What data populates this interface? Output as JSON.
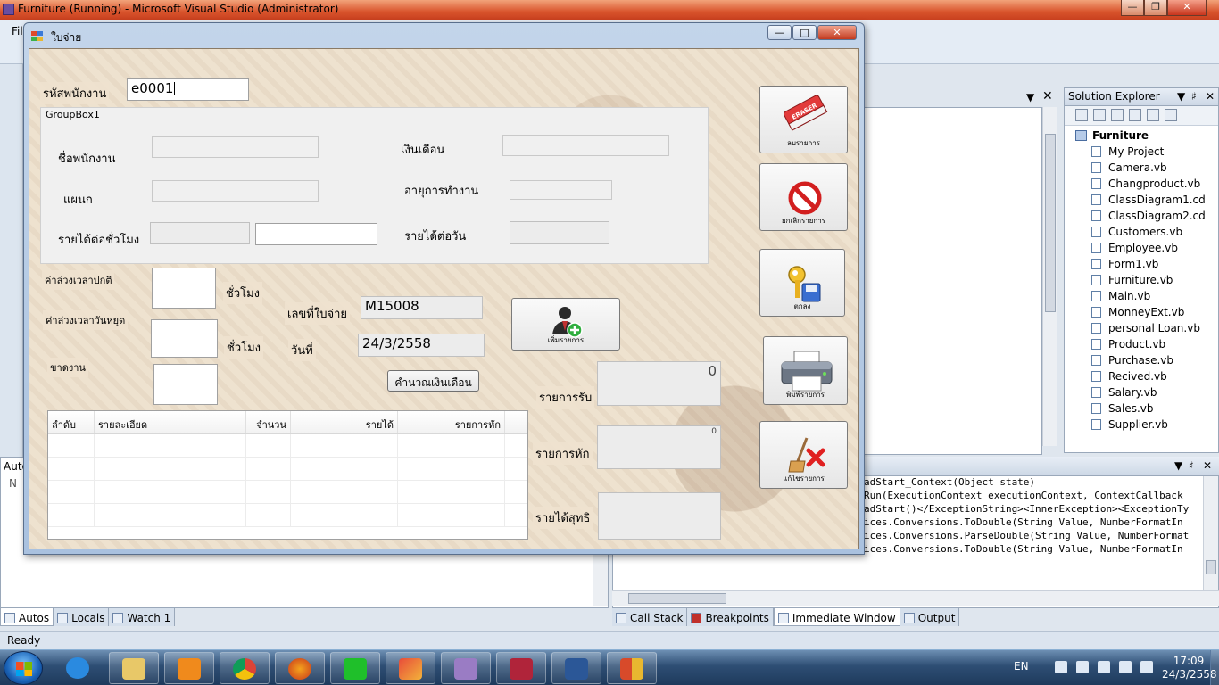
{
  "vs": {
    "title": "Furniture (Running) - Microsoft Visual Studio (Administrator)",
    "menu_partial": "Fil",
    "status": "Ready",
    "solution_explorer": {
      "title": "Solution Explorer",
      "root": "Furniture",
      "items": [
        "My Project",
        "Camera.vb",
        "Changproduct.vb",
        "ClassDiagram1.cd",
        "ClassDiagram2.cd",
        "Customers.vb",
        "Employee.vb",
        "Form1.vb",
        "Furniture.vb",
        "Main.vb",
        "MonneyExt.vb",
        "personal Loan.vb",
        "Product.vb",
        "Purchase.vb",
        "Recived.vb",
        "Salary.vb",
        "Sales.vb",
        "Supplier.vb"
      ]
    },
    "autos": {
      "title": "Auto",
      "header": "N"
    },
    "immediate_lines": [
      "adStart_Context(Object state)",
      "Run(ExecutionContext executionContext, ContextCallback",
      "adStart()</ExceptionString><InnerException><ExceptionTy",
      "ices.Conversions.ToDouble(String Value, NumberFormatIn",
      "ices.Conversions.ParseDouble(String Value, NumberFormat",
      "ices.Conversions.ToDouble(String Value, NumberFormatIn"
    ],
    "left_tabs": [
      "Autos",
      "Locals",
      "Watch 1"
    ],
    "right_tabs": [
      "Call Stack",
      "Breakpoints",
      "Immediate Window",
      "Output"
    ]
  },
  "taskbar": {
    "lang": "EN",
    "time": "17:09",
    "date": "24/3/2558"
  },
  "form": {
    "title": "ใบจ่าย",
    "employee_id_label": "รหัสพนักงาน",
    "employee_id_value": "e0001",
    "groupbox_title": "GroupBox1",
    "name_label": "ชื่อพนักงาน",
    "dept_label": "แผนก",
    "hourly_label": "รายได้ต่อชั่วโมง",
    "salary_label": "เงินเดือน",
    "tenure_label": "อายุการทำงาน",
    "daily_label": "รายได้ต่อวัน",
    "ot_normal_label": "ค่าล่วงเวลาปกติ",
    "ot_holiday_label": "ค่าล่วงเวลาวันหยุด",
    "absent_label": "ขาดงาน",
    "hour_unit": "ชั่วโมง",
    "hour_unit2": "ชั่วโมง",
    "payslip_no_label": "เลขที่ใบจ่าย",
    "payslip_no_value": "M15008",
    "date_label": "วันที่",
    "date_value": "24/3/2558",
    "calc_button": "คำนวณเงินเดือน",
    "add_item_button": "เพิ่มรายการ",
    "income_label": "รายการรับ",
    "income_value": "0",
    "deduct_label": "รายการหัก",
    "deduct_value": "0",
    "net_label": "รายได้สุทธิ",
    "grid_headers": [
      "ลำดับ",
      "รายละเอียด",
      "จำนวน",
      "รายได้",
      "รายการหัก"
    ],
    "side_buttons": [
      "ลบรายการ",
      "ยกเลิกรายการ",
      "ตกลง",
      "พิมพ์รายการ",
      "แก้ไขรายการ"
    ]
  }
}
